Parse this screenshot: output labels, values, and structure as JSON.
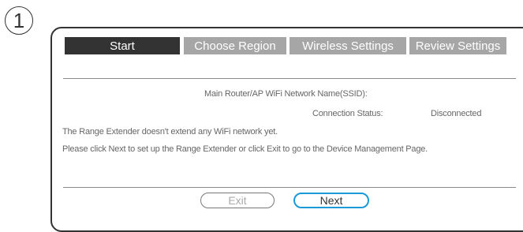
{
  "step": {
    "number": "1"
  },
  "tabs": [
    {
      "label": "Start",
      "active": true
    },
    {
      "label": "Choose Region",
      "active": false
    },
    {
      "label": "Wireless Settings",
      "active": false
    },
    {
      "label": "Review Settings",
      "active": false
    }
  ],
  "main": {
    "ssid_label": "Main Router/AP WiFi Network Name(SSID):",
    "ssid_value": "",
    "connection_status_label": "Connection Status:",
    "connection_status_value": "Disconnected",
    "message_line1": "The Range Extender doesn't extend any WiFi network yet.",
    "message_line2": "Please click Next to set up the Range Extender or click Exit to go to the Device Management Page."
  },
  "buttons": {
    "exit_label": "Exit",
    "next_label": "Next"
  },
  "colors": {
    "active_tab": "#333333",
    "inactive_tab": "#a6a6a6",
    "next_border": "#1a9ad6"
  }
}
